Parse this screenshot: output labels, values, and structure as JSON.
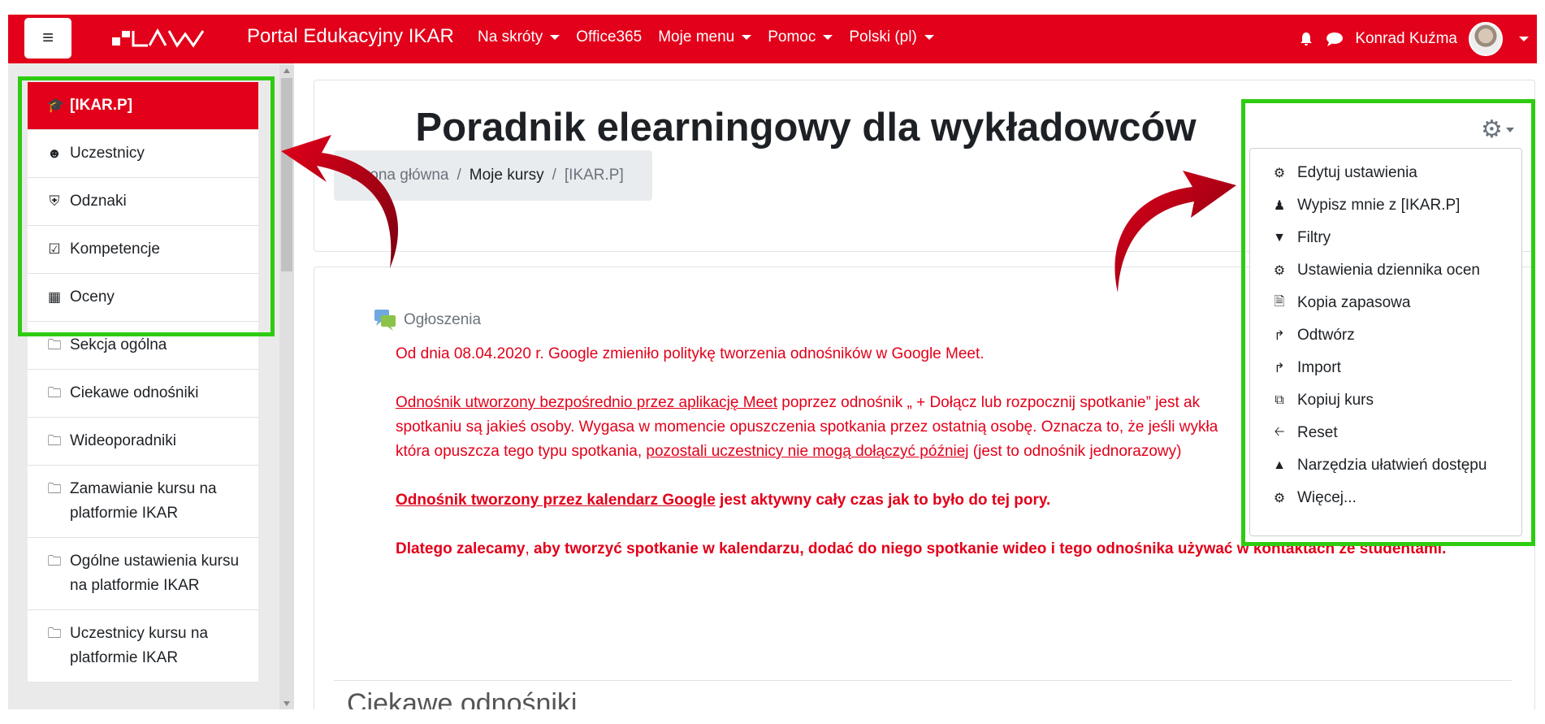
{
  "navbar": {
    "site_name": "Portal Edukacyjny IKAR",
    "items": [
      {
        "label": "Na skróty",
        "has_caret": true
      },
      {
        "label": "Office365",
        "has_caret": false
      },
      {
        "label": "Moje menu",
        "has_caret": true
      },
      {
        "label": "Pomoc",
        "has_caret": true
      },
      {
        "label": "Polski (pl)",
        "has_caret": true
      }
    ],
    "user_name": "Konrad Kuźma",
    "accent_color": "#e2001a"
  },
  "sidebar": {
    "items": [
      {
        "label": "[IKAR.P]",
        "icon": "graduation-cap-icon",
        "active": true
      },
      {
        "label": "Uczestnicy",
        "icon": "users-icon",
        "active": false
      },
      {
        "label": "Odznaki",
        "icon": "shield-icon",
        "active": false
      },
      {
        "label": "Kompetencje",
        "icon": "checkbox-icon",
        "active": false
      },
      {
        "label": "Oceny",
        "icon": "table-icon",
        "active": false
      },
      {
        "label": "Sekcja ogólna",
        "icon": "folder-icon",
        "active": false
      },
      {
        "label": "Ciekawe odnośniki",
        "icon": "folder-icon",
        "active": false
      },
      {
        "label": "Wideoporadniki",
        "icon": "folder-icon",
        "active": false
      },
      {
        "label": "Zamawianie kursu na platformie IKAR",
        "icon": "folder-icon",
        "active": false
      },
      {
        "label": "Ogólne ustawienia kursu na platformie IKAR",
        "icon": "folder-icon",
        "active": false
      },
      {
        "label": "Uczestnicy kursu na platformie IKAR",
        "icon": "folder-icon",
        "active": false
      }
    ]
  },
  "header": {
    "title": "Poradnik elearningowy dla wykładowców",
    "breadcrumb": {
      "home": "Strona główna",
      "sep1": "/",
      "my_courses": "Moje kursy",
      "sep2": "/",
      "current": "[IKAR.P]"
    }
  },
  "content": {
    "forum_title": "Ogłoszenia",
    "p1": "Od dnia 08.04.2020 r. Google zmieniło politykę tworzenia odnośników w Google Meet.",
    "p2_link1": "Odnośnik utworzony bezpośrednio przez aplikację Meet",
    "p2_text1": " poprzez odnośnik „ + Dołącz lub rozpocznij spotkanie” jest ak",
    "p2_line2": "spotkaniu są jakieś osoby. Wygasa w momencie opuszczenia spotkania przez ostatnią osobę. Oznacza to, że jeśli wykła",
    "p2_line3_pre": "która opuszcza tego typu spotkania, ",
    "p2_link2": "pozostali uczestnicy nie mogą dołączyć później",
    "p2_line3_post": " (jest to odnośnik jednorazowy)",
    "p3_link": "Odnośnik tworzony przez kalendarz Google",
    "p3_text": " jest aktywny cały czas jak to było do tej pory.",
    "p4_bold1": "Dlatego zalecamy",
    "p4_normal": ", ",
    "p4_bold2": "aby tworzyć spotkanie w kalendarzu, dodać do niego spotkanie wideo i tego odnośnika używać w kontaktach ze studentami.",
    "section_title": "Ciekawe odnośniki"
  },
  "settings_menu": {
    "items": [
      {
        "label": "Edytuj ustawienia",
        "icon": "gear-icon"
      },
      {
        "label": "Wypisz mnie z [IKAR.P]",
        "icon": "user-icon"
      },
      {
        "label": "Filtry",
        "icon": "filter-icon"
      },
      {
        "label": "Ustawienia dziennika ocen",
        "icon": "gear-icon"
      },
      {
        "label": "Kopia zapasowa",
        "icon": "file-archive-icon"
      },
      {
        "label": "Odtwórz",
        "icon": "restore-icon"
      },
      {
        "label": "Import",
        "icon": "import-icon"
      },
      {
        "label": "Kopiuj kurs",
        "icon": "copy-icon"
      },
      {
        "label": "Reset",
        "icon": "arrow-left-icon"
      },
      {
        "label": "Narzędzia ułatwień dostępu",
        "icon": "chart-area-icon"
      },
      {
        "label": "Więcej...",
        "icon": "gear-icon"
      }
    ]
  },
  "annotation_colors": {
    "highlight": "#2ecc11",
    "arrow": "#c4001a"
  }
}
